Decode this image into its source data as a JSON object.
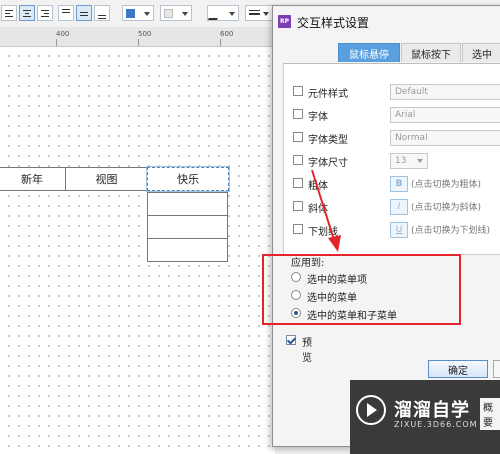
{
  "ruler": {
    "marks": [
      "400",
      "500",
      "600"
    ]
  },
  "canvas": {
    "menu_items": [
      "新年",
      "视图",
      "快乐"
    ]
  },
  "dialog": {
    "app_icon": "RP",
    "title": "交互样式设置",
    "tabs": [
      "鼠标悬停",
      "鼠标按下",
      "选中"
    ],
    "properties": [
      {
        "label": "元件样式",
        "value": "Default",
        "type": "select"
      },
      {
        "label": "字体",
        "value": "Arial",
        "type": "select"
      },
      {
        "label": "字体类型",
        "value": "Normal",
        "type": "select"
      },
      {
        "label": "字体尺寸",
        "value": "13",
        "type": "select"
      },
      {
        "label": "粗体",
        "button": "B",
        "hint": "(点击切换为粗体)",
        "type": "toggle"
      },
      {
        "label": "斜体",
        "button": "I",
        "hint": "(点击切换为斜体)",
        "type": "toggle"
      },
      {
        "label": "下划线",
        "button": "U",
        "hint": "(点击切换为下划线)",
        "type": "toggle"
      }
    ],
    "apply_to": {
      "title": "应用到:",
      "options": [
        "选中的菜单项",
        "选中的菜单",
        "选中的菜单和子菜单"
      ],
      "selected_index": 2
    },
    "preview_label": "预览",
    "ok_label": "确定"
  },
  "bottom_panel_tab": "概要",
  "watermark": {
    "name": "溜溜自学",
    "url": "ZIXUE.3D66.COM"
  },
  "colors": {
    "highlight": "#e3242b",
    "tab_active": "#5a9fe0"
  }
}
